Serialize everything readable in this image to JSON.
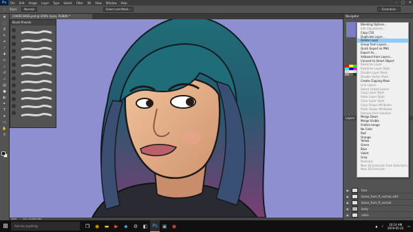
{
  "app": {
    "logo": "Ps",
    "menus": [
      "File",
      "Edit",
      "Image",
      "Layer",
      "Type",
      "Select",
      "Filter",
      "3D",
      "View",
      "Window",
      "Help"
    ],
    "window_controls": [
      "–",
      "□",
      "✕"
    ]
  },
  "options_bar": {
    "mode_label": "Style:",
    "mode_value": "Normal",
    "select_mask_label": "Select and Mask...",
    "workspace_value": "Essentials"
  },
  "document": {
    "tab_title": "CHARE BASS.psd @ 200% (eyes, RGB/8) *",
    "zoom": "200%",
    "doc_info": "Doc: 24.9M/1.98G"
  },
  "brush_panel": {
    "title": "Brush Presets"
  },
  "right_panel": {
    "navigator_title": "Navigator",
    "layers_title": "Layers",
    "layers": [
      {
        "name": "face"
      },
      {
        "name": "bases_from_fl_normal_edit"
      },
      {
        "name": "bases_from_fl_normal"
      },
      {
        "name": "body"
      },
      {
        "name": "sahla"
      }
    ]
  },
  "context_menu": {
    "items": [
      {
        "label": "Blending Options...",
        "disabled": false,
        "highlight": false
      },
      {
        "label": "Edit Adjustment...",
        "disabled": true,
        "highlight": false
      },
      {
        "label": "Copy CSS",
        "disabled": false,
        "highlight": false
      },
      {
        "label": "Duplicate Layer...",
        "disabled": false,
        "highlight": false
      },
      {
        "label": "Delete Layer",
        "disabled": false,
        "highlight": true
      },
      {
        "label": "Group from Layers...",
        "disabled": false,
        "highlight": false
      },
      {
        "label": "Quick Export as PNG",
        "disabled": false,
        "highlight": false
      },
      {
        "label": "Export As...",
        "disabled": false,
        "highlight": false
      },
      {
        "label": "Artboard from Layers...",
        "disabled": false,
        "highlight": false
      },
      {
        "label": "Convert to Smart Object",
        "disabled": false,
        "highlight": false
      },
      {
        "label": "Rasterize Layer",
        "disabled": true,
        "highlight": false
      },
      {
        "label": "Rasterize Layer Style",
        "disabled": true,
        "highlight": false
      },
      {
        "label": "Disable Layer Mask",
        "disabled": true,
        "highlight": false
      },
      {
        "label": "Disable Vector Mask",
        "disabled": true,
        "highlight": false
      },
      {
        "label": "Create Clipping Mask",
        "disabled": false,
        "highlight": false
      },
      {
        "label": "Link Layers",
        "disabled": true,
        "highlight": false
      },
      {
        "label": "Select Linked Layers",
        "disabled": true,
        "highlight": false
      },
      {
        "label": "Copy Layer Style",
        "disabled": true,
        "highlight": false
      },
      {
        "label": "Paste Layer Style",
        "disabled": true,
        "highlight": false
      },
      {
        "label": "Clear Layer Style",
        "disabled": true,
        "highlight": false
      },
      {
        "label": "Copy Shape Attributes",
        "disabled": true,
        "highlight": false
      },
      {
        "label": "Paste Shape Attributes",
        "disabled": true,
        "highlight": false
      },
      {
        "label": "Release from Isolation",
        "disabled": true,
        "highlight": false
      },
      {
        "label": "Merge Down",
        "disabled": false,
        "highlight": false
      },
      {
        "label": "Merge Visible",
        "disabled": false,
        "highlight": false
      },
      {
        "label": "Flatten Image",
        "disabled": false,
        "highlight": false
      },
      {
        "label": "No Color",
        "disabled": false,
        "highlight": false
      },
      {
        "label": "Red",
        "disabled": false,
        "highlight": false
      },
      {
        "label": "Orange",
        "disabled": false,
        "highlight": false
      },
      {
        "label": "Yellow",
        "disabled": false,
        "highlight": false
      },
      {
        "label": "Green",
        "disabled": false,
        "highlight": false
      },
      {
        "label": "Blue",
        "disabled": false,
        "highlight": false
      },
      {
        "label": "Violet",
        "disabled": false,
        "highlight": false
      },
      {
        "label": "Gray",
        "disabled": false,
        "highlight": false
      },
      {
        "label": "Postcard",
        "disabled": true,
        "highlight": false
      },
      {
        "label": "New 3D Extrusion from Selected Layer",
        "disabled": true,
        "highlight": false
      },
      {
        "label": "New 3D Extrusion",
        "disabled": true,
        "highlight": false
      }
    ]
  },
  "taskbar": {
    "search_placeholder": "Ask me anything",
    "time": "10:14 AM",
    "date": "2019-05-22"
  },
  "colors": {
    "canvas_bg": "#8e8fd0",
    "hair_teal": "#1f6e78",
    "hair_purple": "#7a3f73",
    "skin": "#e6b08a",
    "highlight": "#91c9f7"
  }
}
